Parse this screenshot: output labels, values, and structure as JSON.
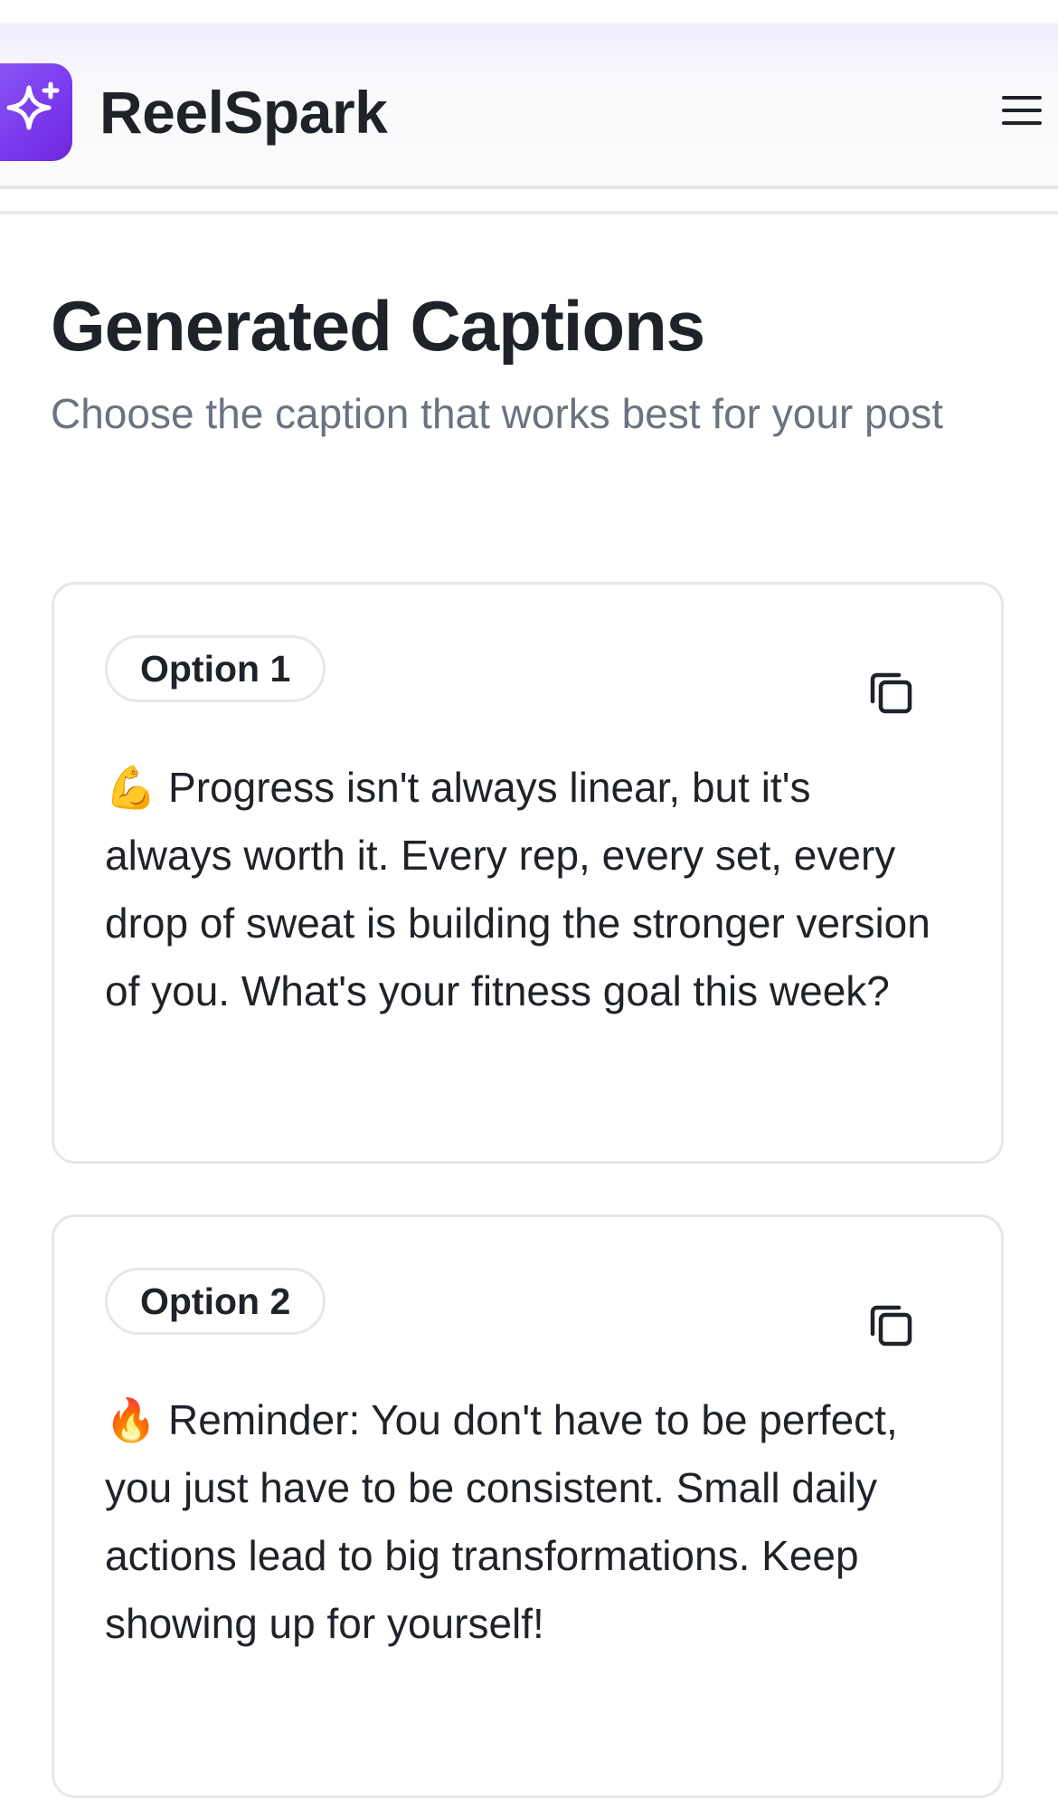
{
  "header": {
    "app_name": "ReelSpark",
    "logo_icon": "sparkles-icon",
    "menu_icon": "hamburger-menu-icon"
  },
  "main": {
    "title": "Generated Captions",
    "subtitle": "Choose the caption that works best for your post",
    "captions": [
      {
        "label": "Option 1",
        "text": "💪 Progress isn't always linear, but it's always worth it. Every rep, every set, every drop of sweat is building the stronger version of you. What's your fitness goal this week?",
        "copy_icon": "copy-icon"
      },
      {
        "label": "Option 2",
        "text": "🔥 Reminder: You don't have to be perfect, you just have to be consistent. Small daily actions lead to big transformations. Keep showing up for yourself!",
        "copy_icon": "copy-icon"
      }
    ]
  },
  "colors": {
    "brand": "#7c3aed",
    "text_primary": "#1f2329",
    "text_secondary": "#6b7280",
    "border": "#e5e7eb"
  }
}
